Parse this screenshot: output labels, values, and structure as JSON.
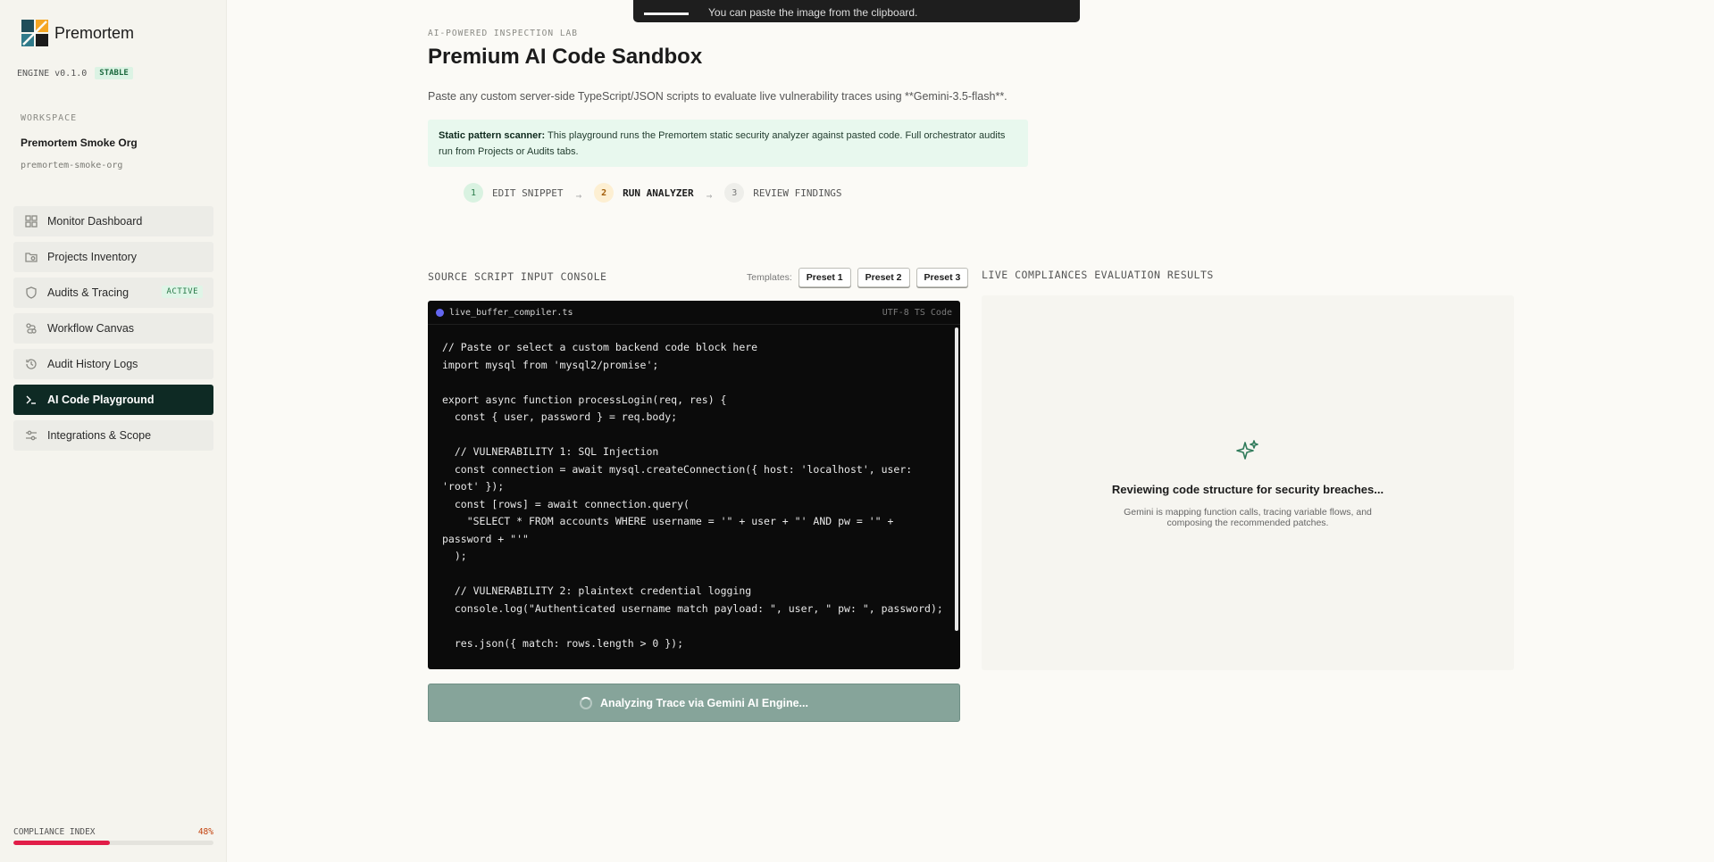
{
  "toast": {
    "text": "You can paste the image from the clipboard."
  },
  "sidebar": {
    "brand": "Premortem",
    "engine_version": "ENGINE v0.1.0",
    "engine_status": "STABLE",
    "workspace_label": "WORKSPACE",
    "workspace_name": "Premortem Smoke Org",
    "workspace_slug": "premortem-smoke-org",
    "items": [
      {
        "label": "Monitor Dashboard",
        "icon": "grid-icon"
      },
      {
        "label": "Projects Inventory",
        "icon": "folder-search-icon"
      },
      {
        "label": "Audits & Tracing",
        "icon": "shield-icon",
        "tag": "ACTIVE"
      },
      {
        "label": "Workflow Canvas",
        "icon": "workflow-icon"
      },
      {
        "label": "Audit History Logs",
        "icon": "history-icon"
      },
      {
        "label": "AI Code Playground",
        "icon": "terminal-icon",
        "active": true
      },
      {
        "label": "Integrations & Scope",
        "icon": "sliders-icon"
      }
    ],
    "compliance": {
      "label": "COMPLIANCE INDEX",
      "value_text": "48%",
      "value": 0.48,
      "color": "#e11d48"
    }
  },
  "main": {
    "eyebrow": "AI-POWERED INSPECTION LAB",
    "title": "Premium AI Code Sandbox",
    "description": "Paste any custom server-side TypeScript/JSON scripts to evaluate live vulnerability traces using **Gemini-3.5-flash**.",
    "notice": {
      "bold": "Static pattern scanner:",
      "text": " This playground runs the Premortem static security analyzer against pasted code. Full orchestrator audits run from Projects or Audits tabs."
    },
    "steps": [
      {
        "num": "1",
        "label": "EDIT SNIPPET"
      },
      {
        "num": "2",
        "label": "RUN ANALYZER"
      },
      {
        "num": "3",
        "label": "REVIEW FINDINGS"
      }
    ],
    "console_label": "SOURCE SCRIPT INPUT CONSOLE",
    "templates_label": "Templates:",
    "presets": [
      "Preset 1",
      "Preset 2",
      "Preset 3"
    ],
    "editor": {
      "filename": "live_buffer_compiler.ts",
      "encoding": "UTF-8 TS Code",
      "code": "// Paste or select a custom backend code block here\nimport mysql from 'mysql2/promise';\n\nexport async function processLogin(req, res) {\n  const { user, password } = req.body;\n\n  // VULNERABILITY 1: SQL Injection\n  const connection = await mysql.createConnection({ host: 'localhost', user: 'root' });\n  const [rows] = await connection.query(\n    \"SELECT * FROM accounts WHERE username = '\" + user + \"' AND pw = '\" + password + \"'\"\n  );\n\n  // VULNERABILITY 2: plaintext credential logging\n  console.log(\"Authenticated username match payload: \", user, \" pw: \", password);\n\n  res.json({ match: rows.length > 0 });"
    },
    "run_button": "Analyzing Trace via Gemini AI Engine...",
    "results_label": "LIVE COMPLIANCES EVALUATION RESULTS",
    "results": {
      "title": "Reviewing code structure for security breaches...",
      "subtitle": "Gemini is mapping function calls, tracing variable flows, and composing the recommended patches."
    }
  }
}
